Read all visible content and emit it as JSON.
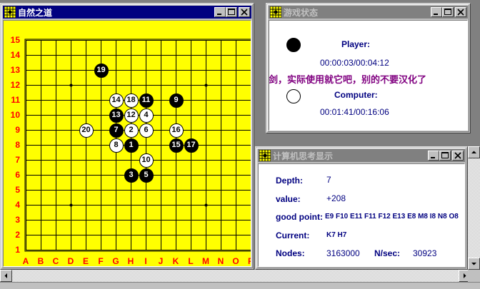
{
  "board_window": {
    "title": "自然之道",
    "ranks": [
      "15",
      "14",
      "13",
      "12",
      "11",
      "10",
      "9",
      "8",
      "7",
      "6",
      "5",
      "4",
      "3",
      "2",
      "1"
    ],
    "files": [
      "A",
      "B",
      "C",
      "D",
      "E",
      "F",
      "G",
      "H",
      "I",
      "J",
      "K",
      "L",
      "M",
      "N",
      "O",
      "P"
    ],
    "board_color": "#ffff00",
    "label_color": "#ff0000",
    "stones": [
      {
        "n": "1",
        "color": "black",
        "col": "H",
        "row": 8
      },
      {
        "n": "2",
        "color": "white",
        "col": "H",
        "row": 9
      },
      {
        "n": "3",
        "color": "black",
        "col": "H",
        "row": 6
      },
      {
        "n": "4",
        "color": "white",
        "col": "I",
        "row": 10
      },
      {
        "n": "5",
        "color": "black",
        "col": "I",
        "row": 6
      },
      {
        "n": "6",
        "color": "white",
        "col": "I",
        "row": 9
      },
      {
        "n": "7",
        "color": "black",
        "col": "G",
        "row": 9
      },
      {
        "n": "8",
        "color": "white",
        "col": "G",
        "row": 8
      },
      {
        "n": "9",
        "color": "black",
        "col": "K",
        "row": 11
      },
      {
        "n": "10",
        "color": "white",
        "col": "I",
        "row": 7
      },
      {
        "n": "11",
        "color": "black",
        "col": "I",
        "row": 11
      },
      {
        "n": "12",
        "color": "white",
        "col": "H",
        "row": 10
      },
      {
        "n": "13",
        "color": "black",
        "col": "G",
        "row": 10
      },
      {
        "n": "14",
        "color": "white",
        "col": "G",
        "row": 11
      },
      {
        "n": "15",
        "color": "black",
        "col": "K",
        "row": 8
      },
      {
        "n": "16",
        "color": "white",
        "col": "K",
        "row": 9
      },
      {
        "n": "17",
        "color": "black",
        "col": "L",
        "row": 8
      },
      {
        "n": "18",
        "color": "white",
        "col": "H",
        "row": 11
      },
      {
        "n": "19",
        "color": "black",
        "col": "F",
        "row": 13
      },
      {
        "n": "20",
        "color": "white",
        "col": "E",
        "row": 9
      }
    ],
    "star_points": [
      {
        "col": "D",
        "row": 12
      },
      {
        "col": "M",
        "row": 12
      },
      {
        "col": "D",
        "row": 4
      },
      {
        "col": "M",
        "row": 4
      }
    ]
  },
  "status_window": {
    "title": "游戏状态",
    "player_label": "Player:",
    "player_time": "00:00:03/00:04:12",
    "note": "剑，实际使用就它吧，别的不要汉化了",
    "computer_label": "Computer:",
    "computer_time": "00:01:41/00:16:06"
  },
  "think_window": {
    "title": "计算机思考显示",
    "depth_label": "Depth:",
    "depth_value": "7",
    "value_label": "value:",
    "value_value": "+208",
    "good_points_label": "good point:",
    "good_points_value": "E9 F10 E11 F11 F12 E13 E8 M8 I8 N8 O8",
    "current_label": "Current:",
    "current_value": "K7 H7",
    "nodes_label": "Nodes:",
    "nodes_value": "3163000",
    "nsec_label": "N/sec:",
    "nsec_value": "30923"
  }
}
